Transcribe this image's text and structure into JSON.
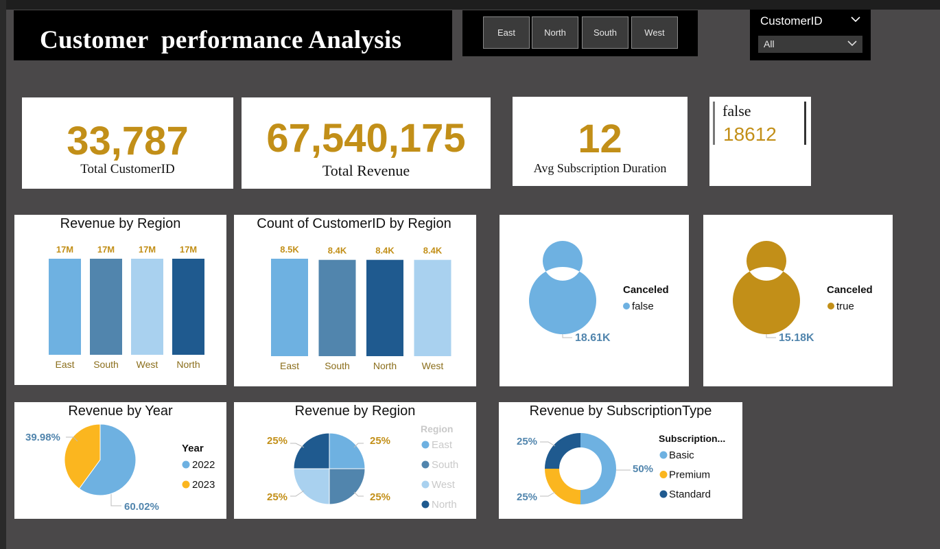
{
  "header": {
    "title": "Customer  performance Analysis"
  },
  "region_slicer": {
    "options": [
      "East",
      "North",
      "South",
      "West"
    ]
  },
  "customer_filter": {
    "label": "CustomerID",
    "selected": "All"
  },
  "kpis": {
    "total_customers": {
      "value": "33,787",
      "label": "Total CustomerID"
    },
    "total_revenue": {
      "value": "67,540,175",
      "label": "Total Revenue"
    },
    "avg_duration": {
      "value": "12",
      "label": "Avg Subscription Duration"
    },
    "canceled_card": {
      "label": "false",
      "value": "18612"
    }
  },
  "colors": {
    "light_blue": "#6eb1e1",
    "steel_blue": "#5185ad",
    "pale_blue": "#a9d1ef",
    "dark_blue": "#1f5a8f",
    "gold": "#c28f18",
    "amber": "#fbb61f"
  },
  "charts": {
    "revenue_by_region_bar": {
      "title": "Revenue by Region"
    },
    "count_by_region_bar": {
      "title": "Count of CustomerID by Region"
    },
    "canceled_false": {
      "legend_title": "Canceled",
      "legend_item": "false",
      "value_label": "18.61K"
    },
    "canceled_true": {
      "legend_title": "Canceled",
      "legend_item": "true",
      "value_label": "15.18K"
    },
    "revenue_by_year": {
      "title": "Revenue by Year",
      "legend_title": "Year"
    },
    "revenue_by_region_pie": {
      "title": "Revenue by Region",
      "legend_title": "Region"
    },
    "revenue_by_subscription": {
      "title": "Revenue by SubscriptionType",
      "legend_title": "Subscription..."
    }
  },
  "chart_data": [
    {
      "type": "bar",
      "title": "Revenue by Region",
      "categories": [
        "East",
        "South",
        "West",
        "North"
      ],
      "values": [
        17000000,
        17000000,
        17000000,
        17000000
      ],
      "data_labels": [
        "17M",
        "17M",
        "17M",
        "17M"
      ],
      "colors": [
        "#6eb1e1",
        "#5185ad",
        "#a9d1ef",
        "#1f5a8f"
      ]
    },
    {
      "type": "bar",
      "title": "Count of CustomerID by Region",
      "categories": [
        "East",
        "South",
        "North",
        "West"
      ],
      "values": [
        8500,
        8400,
        8400,
        8400
      ],
      "data_labels": [
        "8.5K",
        "8.4K",
        "8.4K",
        "8.4K"
      ],
      "colors": [
        "#6eb1e1",
        "#5185ad",
        "#1f5a8f",
        "#a9d1ef"
      ]
    },
    {
      "type": "pie",
      "donut": true,
      "legend_title": "Canceled",
      "categories": [
        "false"
      ],
      "values": [
        18612
      ],
      "data_labels": [
        "18.61K"
      ],
      "colors": [
        "#6eb1e1"
      ]
    },
    {
      "type": "pie",
      "donut": true,
      "legend_title": "Canceled",
      "categories": [
        "true"
      ],
      "values": [
        15180
      ],
      "data_labels": [
        "15.18K"
      ],
      "colors": [
        "#c28f18"
      ]
    },
    {
      "type": "pie",
      "title": "Revenue by Year",
      "legend_title": "Year",
      "categories": [
        "2022",
        "2023"
      ],
      "values": [
        60.02,
        39.98
      ],
      "data_labels": [
        "60.02%",
        "39.98%"
      ],
      "colors": [
        "#6eb1e1",
        "#fbb61f"
      ]
    },
    {
      "type": "pie",
      "title": "Revenue by Region",
      "legend_title": "Region",
      "categories": [
        "East",
        "South",
        "West",
        "North"
      ],
      "values": [
        25,
        25,
        25,
        25
      ],
      "data_labels": [
        "25%",
        "25%",
        "25%",
        "25%"
      ],
      "colors": [
        "#6eb1e1",
        "#5185ad",
        "#a9d1ef",
        "#1f5a8f"
      ]
    },
    {
      "type": "pie",
      "donut": true,
      "title": "Revenue by SubscriptionType",
      "legend_title": "Subscription...",
      "categories": [
        "Basic",
        "Premium",
        "Standard"
      ],
      "values": [
        50,
        25,
        25
      ],
      "data_labels": [
        "50%",
        "25%",
        "25%"
      ],
      "colors": [
        "#6eb1e1",
        "#fbb61f",
        "#1f5a8f"
      ]
    }
  ]
}
